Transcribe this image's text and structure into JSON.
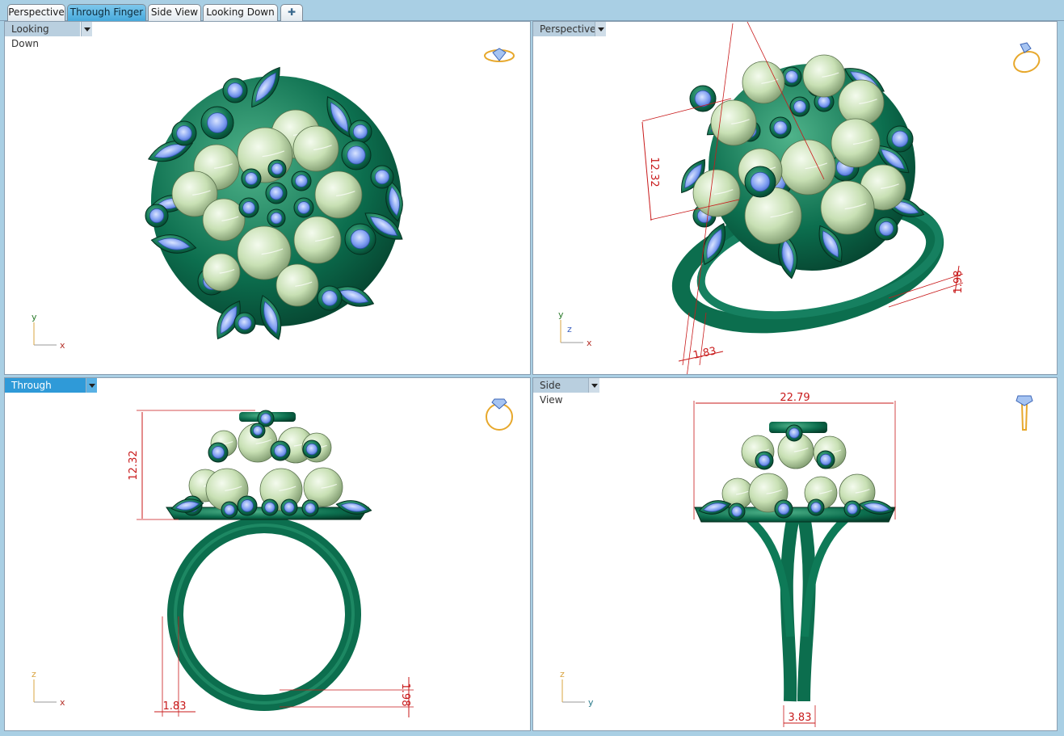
{
  "tabs": [
    {
      "label": "Perspective",
      "active": false
    },
    {
      "label": "Through Finger",
      "active": true
    },
    {
      "label": "Side View",
      "active": false
    },
    {
      "label": "Looking Down",
      "active": false
    }
  ],
  "add_tab_glyph": "✚",
  "viewports": {
    "top_left": {
      "title": "Looking Down",
      "active": false,
      "axis_x": "x",
      "axis_y": "y",
      "icon": "ring-top-icon"
    },
    "top_right": {
      "title": "Perspective",
      "active": false,
      "axis_x": "x",
      "axis_y": "y",
      "axis_z": "z",
      "icon": "ring-perspective-icon",
      "dimensions": [
        "12.32",
        "1.98",
        "1.83"
      ]
    },
    "bottom_left": {
      "title": "Through Finger",
      "active": true,
      "axis_x": "x",
      "axis_z": "z",
      "icon": "ring-front-icon",
      "dimensions": [
        "12.32",
        "1.83",
        "1.98"
      ]
    },
    "bottom_right": {
      "title": "Side View",
      "active": false,
      "axis_y": "y",
      "axis_z": "z",
      "icon": "ring-side-icon",
      "dimensions": [
        "22.79",
        "3.83"
      ]
    }
  },
  "colors": {
    "metal_green": "#0c6e4e",
    "metal_highlight": "#4fb38a",
    "pearl": "#c8e0b4",
    "stone_blue": "#7c9cf0",
    "dimension_red": "#c8191a",
    "active_tab": "#2f9ad8"
  }
}
